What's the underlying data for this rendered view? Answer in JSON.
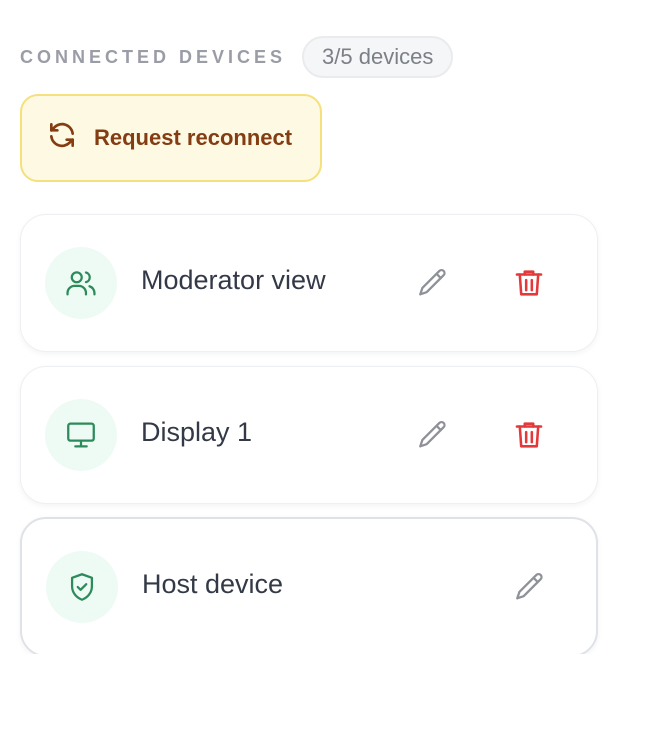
{
  "header": {
    "title": "CONNECTED DEVICES",
    "count": "3/5 devices"
  },
  "reconnect": {
    "label": "Request reconnect",
    "icon": "refresh-icon"
  },
  "devices": [
    {
      "label": "Moderator view",
      "icon": "users-icon",
      "editable": true,
      "removable": true
    },
    {
      "label": "Display 1",
      "icon": "monitor-icon",
      "editable": true,
      "removable": true
    },
    {
      "label": "Host device",
      "icon": "shield-check-icon",
      "editable": true,
      "removable": false
    }
  ],
  "colors": {
    "accent_green": "#2d8a5a",
    "icon_bg": "#eefbf4",
    "delete_red": "#e3393a",
    "edit_gray": "#8e9197",
    "reconnect_bg": "#fef9e3",
    "reconnect_border": "#f5e07c",
    "reconnect_text": "#843d13"
  }
}
